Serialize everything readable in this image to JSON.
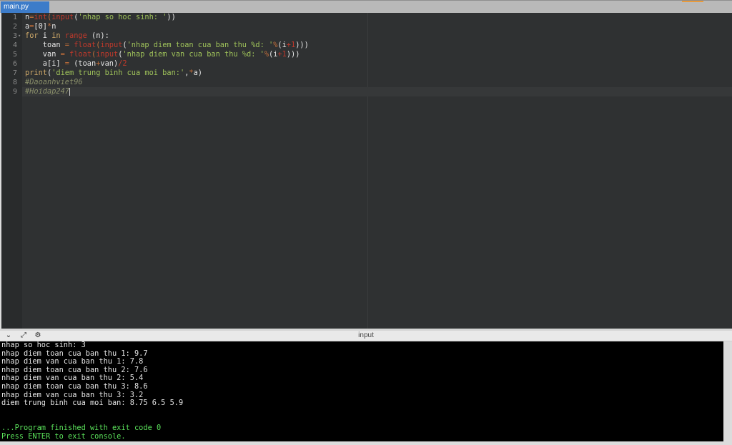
{
  "tab": {
    "label": "main.py"
  },
  "editor": {
    "line_numbers": [
      "1",
      "2",
      "3",
      "4",
      "5",
      "6",
      "7",
      "8",
      "9"
    ],
    "lines": [
      [
        {
          "t": "n",
          "c": ""
        },
        {
          "t": "=",
          "c": "op"
        },
        {
          "t": "int",
          "c": "fn"
        },
        {
          "t": "(",
          "c": "op"
        },
        {
          "t": "input",
          "c": "fn"
        },
        {
          "t": "(",
          "c": ""
        },
        {
          "t": "'nhap so hoc sinh: '",
          "c": "str"
        },
        {
          "t": "))",
          "c": ""
        }
      ],
      [
        {
          "t": "a",
          "c": ""
        },
        {
          "t": "=",
          "c": "op"
        },
        {
          "t": "[0]",
          "c": ""
        },
        {
          "t": "*",
          "c": "op"
        },
        {
          "t": "n",
          "c": ""
        }
      ],
      [
        {
          "t": "for",
          "c": "kw"
        },
        {
          "t": " i ",
          "c": ""
        },
        {
          "t": "in",
          "c": "kw"
        },
        {
          "t": " ",
          "c": ""
        },
        {
          "t": "range",
          "c": "fn"
        },
        {
          "t": " (n):",
          "c": ""
        }
      ],
      [
        {
          "t": "    toan ",
          "c": ""
        },
        {
          "t": "=",
          "c": "op"
        },
        {
          "t": " ",
          "c": ""
        },
        {
          "t": "float",
          "c": "fn"
        },
        {
          "t": "(",
          "c": "op"
        },
        {
          "t": "input",
          "c": "fn"
        },
        {
          "t": "(",
          "c": ""
        },
        {
          "t": "'nhap diem toan cua ban thu %d: '",
          "c": "str"
        },
        {
          "t": "%",
          "c": "op"
        },
        {
          "t": "(i",
          "c": ""
        },
        {
          "t": "+1",
          "c": "num"
        },
        {
          "t": ")))",
          "c": ""
        }
      ],
      [
        {
          "t": "    van ",
          "c": ""
        },
        {
          "t": "=",
          "c": "op"
        },
        {
          "t": " ",
          "c": ""
        },
        {
          "t": "float",
          "c": "fn"
        },
        {
          "t": "(",
          "c": "op"
        },
        {
          "t": "input",
          "c": "fn"
        },
        {
          "t": "(",
          "c": ""
        },
        {
          "t": "'nhap diem van cua ban thu %d: '",
          "c": "str"
        },
        {
          "t": "%",
          "c": "op"
        },
        {
          "t": "(i",
          "c": ""
        },
        {
          "t": "+1",
          "c": "num"
        },
        {
          "t": ")))",
          "c": ""
        }
      ],
      [
        {
          "t": "    a[i] ",
          "c": ""
        },
        {
          "t": "=",
          "c": "op"
        },
        {
          "t": " (toan",
          "c": ""
        },
        {
          "t": "+",
          "c": "op"
        },
        {
          "t": "van)",
          "c": ""
        },
        {
          "t": "/2",
          "c": "num"
        }
      ],
      [
        {
          "t": "print",
          "c": "kw"
        },
        {
          "t": "(",
          "c": ""
        },
        {
          "t": "'diem trung binh cua moi ban:'",
          "c": "str"
        },
        {
          "t": ",",
          "c": ""
        },
        {
          "t": "*",
          "c": "op"
        },
        {
          "t": "a)",
          "c": ""
        }
      ],
      [
        {
          "t": "#Daoanhviet96",
          "c": "cm"
        }
      ],
      [
        {
          "t": "#Hoidap247",
          "c": "cm"
        }
      ]
    ]
  },
  "console": {
    "title": "input",
    "output": [
      "nhap so hoc sinh: 3",
      "nhap diem toan cua ban thu 1: 9.7",
      "nhap diem van cua ban thu 1: 7.8",
      "nhap diem toan cua ban thu 2: 7.6",
      "nhap diem van cua ban thu 2: 5.4",
      "nhap diem toan cua ban thu 3: 8.6",
      "nhap diem van cua ban thu 3: 3.2",
      "diem trung binh cua moi ban: 8.75 6.5 5.9"
    ],
    "finished": "...Program finished with exit code 0",
    "press_enter": "Press ENTER to exit console."
  },
  "icons": [
    "chevron-down-icon",
    "expand-icon",
    "settings-icon"
  ]
}
